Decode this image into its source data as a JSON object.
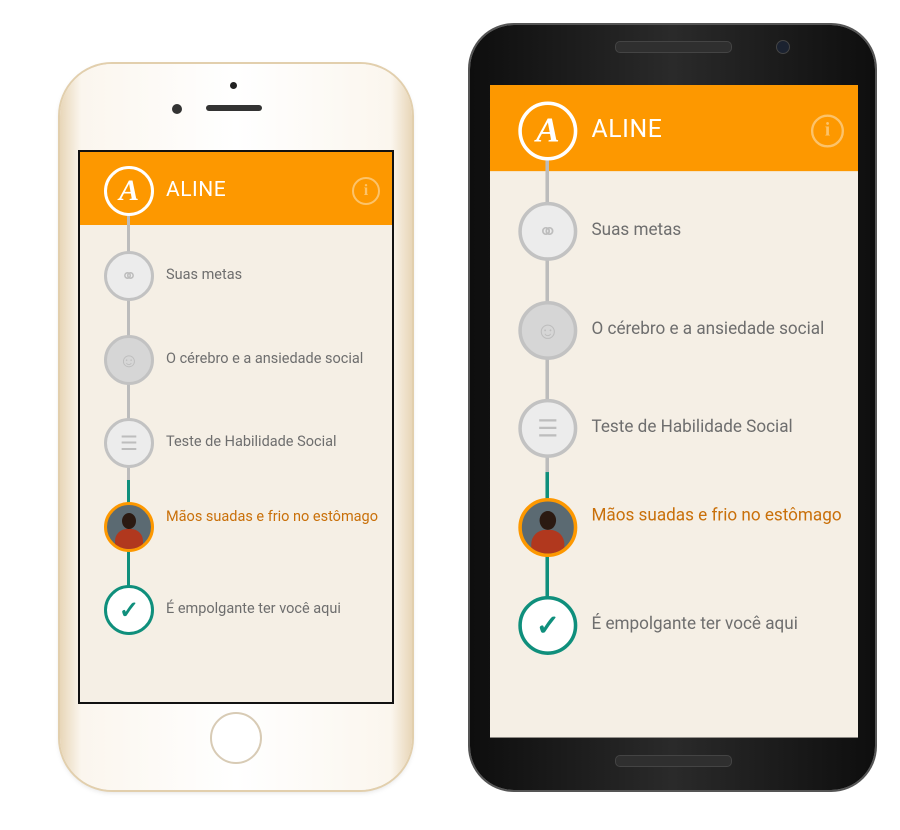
{
  "app": {
    "title": "ALINE",
    "logo_letter": "A",
    "info_icon": "info-person-icon"
  },
  "colors": {
    "header": "#fd9800",
    "background": "#f5efe5",
    "active": "#c9700a",
    "done": "#0f8f7c"
  },
  "steps": [
    {
      "label": "Suas metas",
      "icon": "binoculars-icon",
      "state": "complete"
    },
    {
      "label": "O cérebro e a ansiedade social",
      "icon": "brain-illustration-icon",
      "state": "complete"
    },
    {
      "label": "Teste de Habilidade Social",
      "icon": "clipboard-icon",
      "state": "complete"
    },
    {
      "label": "Mãos suadas e frio no estômago",
      "icon": "person-at-desk-icon",
      "state": "active"
    },
    {
      "label": "É empolgante ter você aqui",
      "icon": "checkmark-icon",
      "state": "goal"
    }
  ]
}
